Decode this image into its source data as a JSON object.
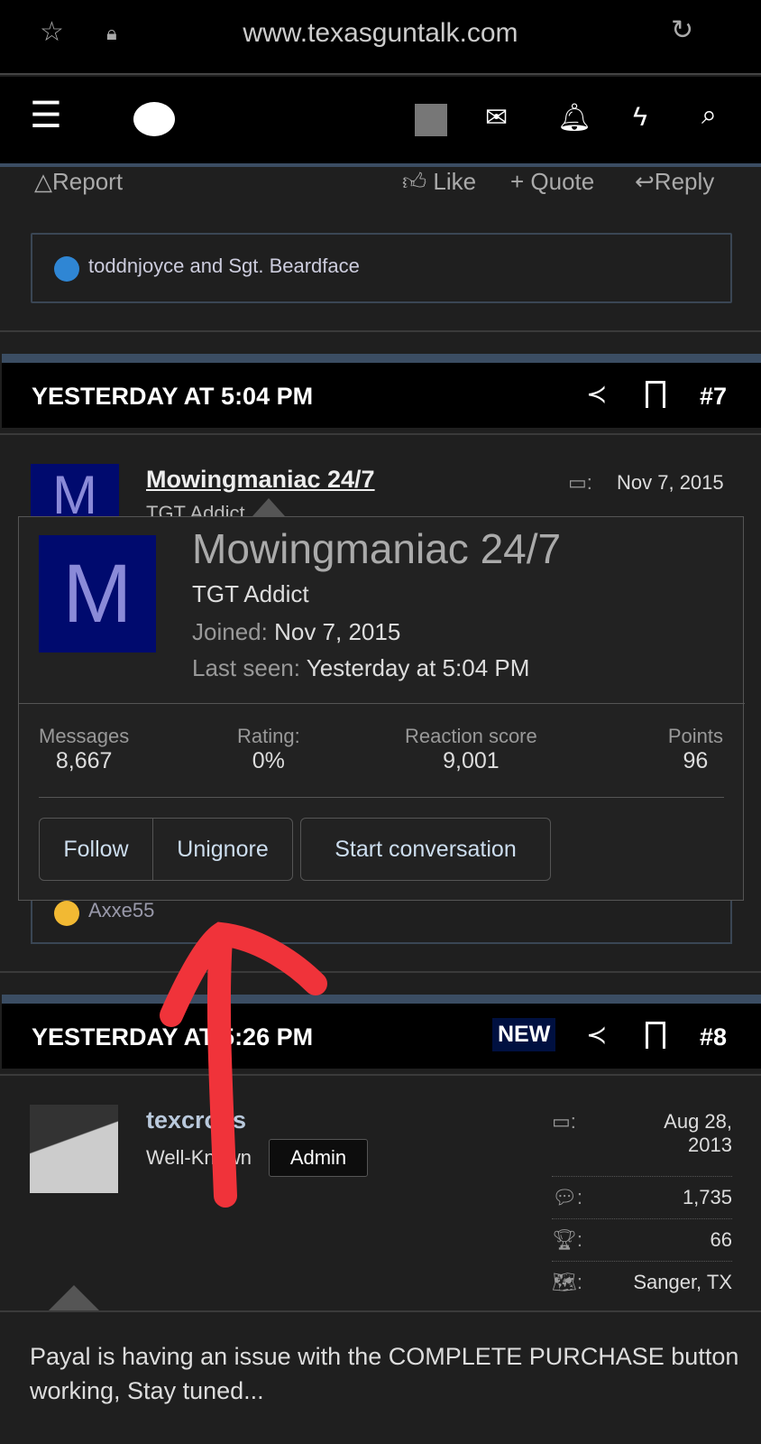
{
  "browser": {
    "url": "www.texasguntalk.com"
  },
  "nav": {
    "icons": [
      "menu-icon",
      "chat-icon",
      "avatar",
      "mail-icon",
      "bell-icon",
      "bolt-icon",
      "search-icon"
    ]
  },
  "prev_post": {
    "actions": {
      "report": "Report",
      "like": "Like",
      "quote": "+ Quote",
      "reply": "Reply"
    },
    "reactions": "toddnjoyce and Sgt. Beardface"
  },
  "post7": {
    "time": "YESTERDAY AT 5:04 PM",
    "number": "#7",
    "author": "Mowingmaniac 24/7",
    "avatar_letter": "M",
    "title": "TGT Addict",
    "joined": "Nov 7, 2015",
    "reactions": "Axxe55"
  },
  "popup": {
    "name": "Mowingmaniac 24/7",
    "avatar_letter": "M",
    "title": "TGT Addict",
    "joined_label": "Joined:",
    "joined": "Nov 7, 2015",
    "last_seen_label": "Last seen:",
    "last_seen": "Yesterday at 5:04 PM",
    "stats": [
      {
        "label": "Messages",
        "value": "8,667"
      },
      {
        "label": "Rating:",
        "value": "0%"
      },
      {
        "label": "Reaction score",
        "value": "9,001"
      },
      {
        "label": "Points",
        "value": "96"
      }
    ],
    "buttons": {
      "follow": "Follow",
      "unignore": "Unignore",
      "conversation": "Start conversation"
    }
  },
  "post8": {
    "time": "YESTERDAY AT 5:26 PM",
    "badge": "NEW",
    "number": "#8",
    "author": "texcross",
    "title": "Well-Known",
    "role": "Admin",
    "joined": "Aug 28, 2013",
    "messages": "1,735",
    "points": "66",
    "location": "Sanger, TX",
    "body": "Payal is having an issue with the COMPLETE PURCHASE button working, Stay tuned..."
  },
  "colors": {
    "accent_bar": "#3b4d63",
    "avatar_bg": "#000a6e",
    "annotation_arrow": "#f0333a"
  }
}
